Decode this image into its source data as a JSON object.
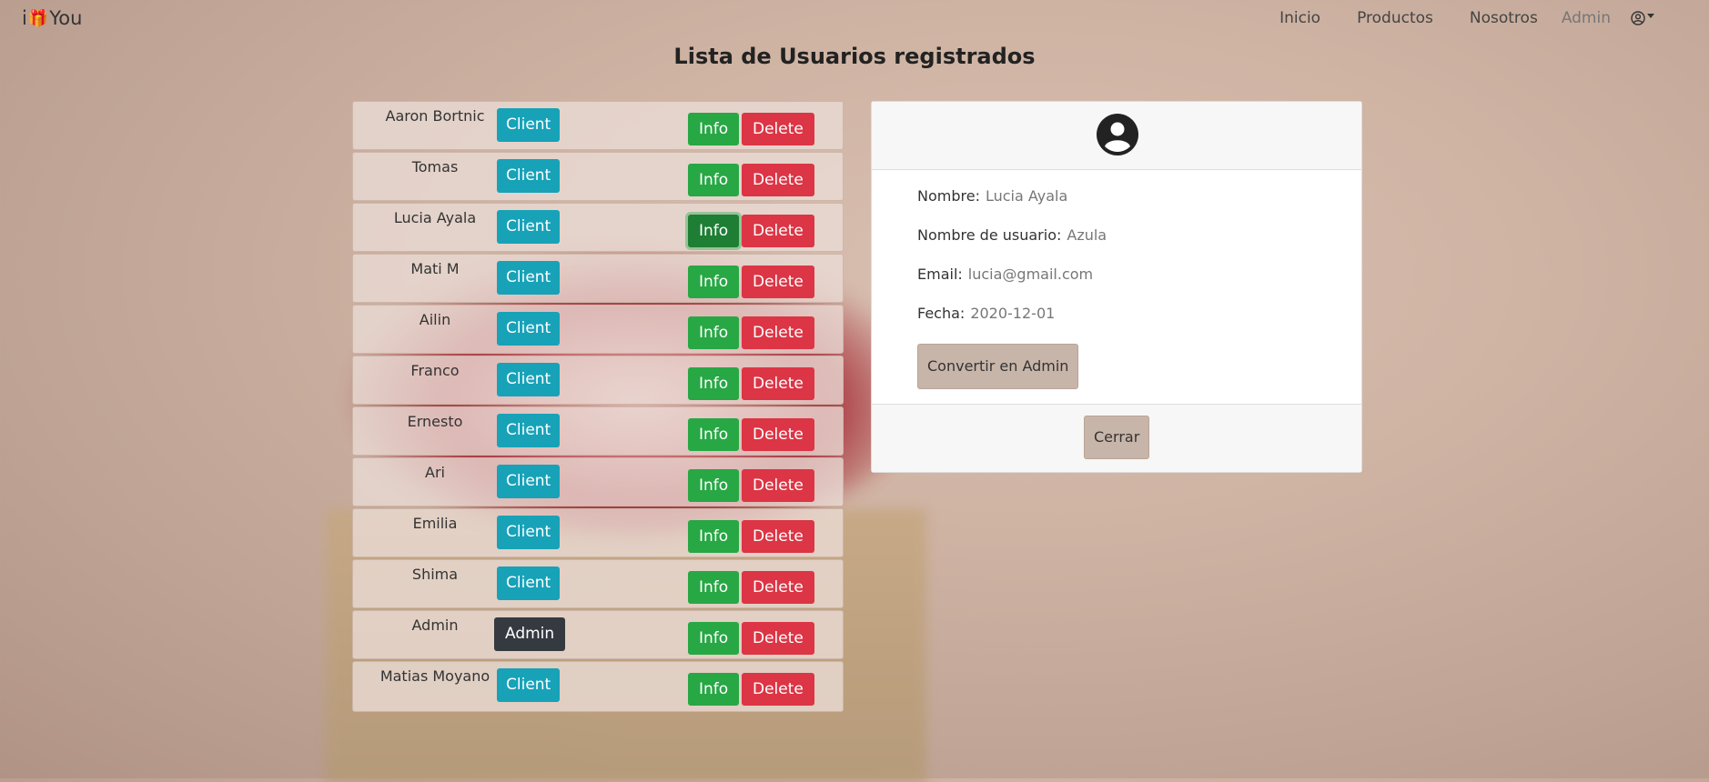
{
  "brand": {
    "prefix": "i",
    "gift_icon": "🎁",
    "suffix": "You"
  },
  "nav": {
    "items": [
      "Inicio",
      "Productos",
      "Nosotros"
    ],
    "admin_label": "Admin"
  },
  "page_title": "Lista de Usuarios registrados",
  "users": [
    {
      "name": "Aaron Bortnic",
      "role": "Client"
    },
    {
      "name": "Tomas",
      "role": "Client"
    },
    {
      "name": "Lucia Ayala",
      "role": "Client"
    },
    {
      "name": "Mati M",
      "role": "Client"
    },
    {
      "name": "Ailin",
      "role": "Client"
    },
    {
      "name": "Franco",
      "role": "Client"
    },
    {
      "name": "Ernesto",
      "role": "Client"
    },
    {
      "name": "Ari",
      "role": "Client"
    },
    {
      "name": "Emilia",
      "role": "Client"
    },
    {
      "name": "Shima",
      "role": "Client"
    },
    {
      "name": "Admin",
      "role": "Admin"
    },
    {
      "name": "Matias Moyano",
      "role": "Client"
    }
  ],
  "row_buttons": {
    "info": "Info",
    "delete": "Delete"
  },
  "details": {
    "nombre_label": "Nombre:",
    "nombre": "Lucia Ayala",
    "usuario_label": "Nombre de usuario:",
    "usuario": "Azula",
    "email_label": "Email:",
    "email": "lucia@gmail.com",
    "fecha_label": "Fecha:",
    "fecha": "2020-12-01",
    "convert_label": "Convertir en Admin",
    "close_label": "Cerrar"
  }
}
